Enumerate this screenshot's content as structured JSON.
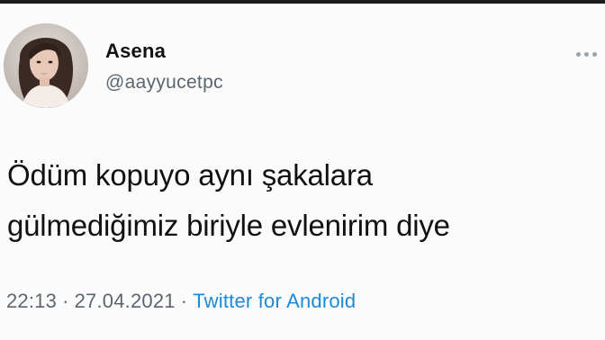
{
  "tweet": {
    "author": {
      "name": "Asena",
      "handle": "@aayyucetpc"
    },
    "text_lines": [
      "Ödüm kopuyo aynı şakalara",
      "gülmediğimiz biriyle evlenirim diye"
    ],
    "meta": {
      "time": "22:13",
      "separator": "·",
      "date": "27.04.2021",
      "source": "Twitter for Android"
    },
    "icons": {
      "more": "more-horizontal-icon"
    },
    "colors": {
      "link": "#1d8ad6",
      "secondary_text": "#5b6670"
    }
  }
}
